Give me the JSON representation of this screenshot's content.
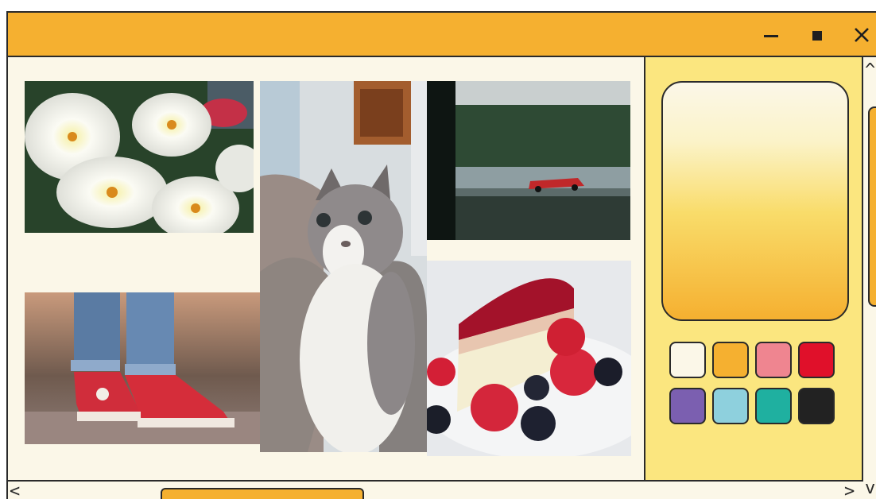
{
  "titlebar": {
    "minimize_icon": "minimize-icon",
    "maximize_icon": "maximize-icon",
    "close_icon": "close-icon",
    "color": "#f5b030"
  },
  "collage": {
    "photos": [
      "white-lilies-photo",
      "gray-white-cat-photo",
      "racing-car-photo",
      "red-sneakers-photo",
      "cheesecake-raspberries-photo"
    ]
  },
  "panel": {
    "background": "#fbe67f",
    "palette": [
      "#fbf7e8",
      "#f5b030",
      "#ef8590",
      "#e0102a",
      "#7b5fb0",
      "#8ed0dd",
      "#1fb0a0",
      "#222222"
    ]
  },
  "scrollbars": {
    "left_arrow": "<",
    "right_arrow": ">",
    "up_arrow": "^",
    "down_arrow": "v"
  }
}
